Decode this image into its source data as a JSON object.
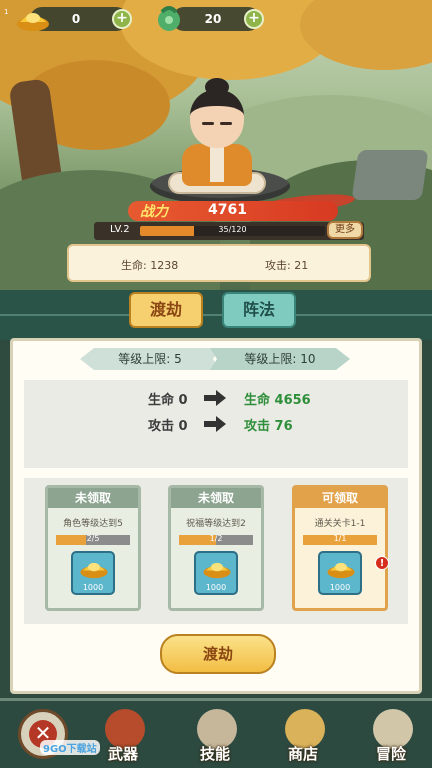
{
  "corner_tag": "1",
  "currency": {
    "gold": {
      "icon": "gold-ingot-icon",
      "value": "0"
    },
    "jade": {
      "icon": "jade-token-icon",
      "value": "20"
    },
    "add_symbol": "+"
  },
  "character": {
    "power_label": "战力",
    "power_value": "4761",
    "level": "LV.2",
    "exp_text": "35/120",
    "exp_fraction": 0.29,
    "more_label": "更多",
    "stats": [
      {
        "label": "生命:",
        "value": "1238"
      },
      {
        "label": "攻击:",
        "value": "21"
      }
    ]
  },
  "tabs": [
    {
      "label": "渡劫",
      "active": true
    },
    {
      "label": "阵法",
      "active": false
    }
  ],
  "level_limits": {
    "current": "等级上限: 5",
    "next": "等级上限: 10"
  },
  "comparison": [
    {
      "current": "生命 0",
      "next": "生命 4656"
    },
    {
      "current": "攻击 0",
      "next": "攻击 76"
    }
  ],
  "rewards": [
    {
      "status": "未领取",
      "task": "角色等级达到5",
      "progress_text": "2/5",
      "progress": 0.4,
      "item": "gold-ingot-icon",
      "qty": "1000",
      "alert": false
    },
    {
      "status": "未领取",
      "task": "祝福等级达到2",
      "progress_text": "1/2",
      "progress": 0.5,
      "item": "gold-ingot-icon",
      "qty": "1000",
      "alert": false
    },
    {
      "status": "可领取",
      "task": "通关关卡1-1",
      "progress_text": "1/1",
      "progress": 1.0,
      "item": "gold-ingot-icon",
      "qty": "1000",
      "alert": true,
      "alert_symbol": "!"
    }
  ],
  "action_button": "渡劫",
  "nav": {
    "close_symbol": "✕",
    "items": [
      {
        "label": "武器",
        "icon": "weapon-icon"
      },
      {
        "label": "技能",
        "icon": "skill-icon"
      },
      {
        "label": "商店",
        "icon": "shop-icon"
      },
      {
        "label": "冒险",
        "icon": "adventure-icon"
      }
    ]
  },
  "watermark": "9GO下载站",
  "colors": {
    "accent_orange": "#e2a24a",
    "up_green": "#2e8f3b",
    "panel_green": "#2b5448"
  }
}
